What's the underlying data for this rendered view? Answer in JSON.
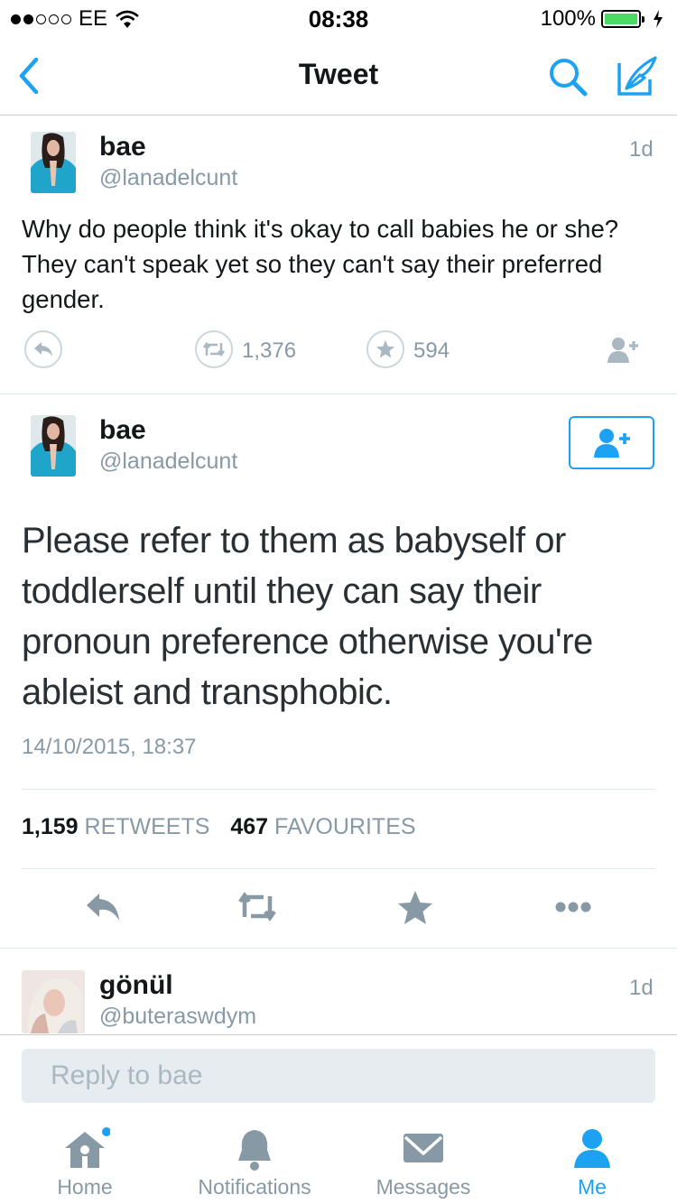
{
  "status_bar": {
    "carrier": "EE",
    "time": "08:38",
    "battery_percent": "100%",
    "signal_bars_filled": 2,
    "signal_bars_total": 5,
    "battery_color": "#4cd964"
  },
  "nav": {
    "title": "Tweet",
    "icons": [
      "back-chevron-icon",
      "search-icon",
      "compose-icon"
    ],
    "accent_color": "#1da1f2"
  },
  "tweet_context": {
    "name": "bae",
    "handle": "@lanadelcunt",
    "age": "1d",
    "text": "Why do people think it's okay to call babies he or she? They can't speak yet so they can't say their preferred gender.",
    "retweet_count": "1,376",
    "favourite_count": "594"
  },
  "main_tweet": {
    "name": "bae",
    "handle": "@lanadelcunt",
    "text": "Please refer to them as babyself or toddlerself until they can say their pronoun preference otherwise you're ableist and transphobic.",
    "date": "14/10/2015, 18:37",
    "retweets_count": "1,159",
    "retweets_label": "RETWEETS",
    "favourites_count": "467",
    "favourites_label": "FAVOURITES"
  },
  "reply_tweet": {
    "name": "gönül",
    "handle": "@buteraswdym",
    "age": "1d"
  },
  "reply_box": {
    "placeholder": "Reply to bae"
  },
  "tabs": [
    {
      "label": "Home",
      "icon": "home-icon",
      "active": false,
      "has_badge": true
    },
    {
      "label": "Notifications",
      "icon": "bell-icon",
      "active": false
    },
    {
      "label": "Messages",
      "icon": "envelope-icon",
      "active": false
    },
    {
      "label": "Me",
      "icon": "person-icon",
      "active": true
    }
  ]
}
